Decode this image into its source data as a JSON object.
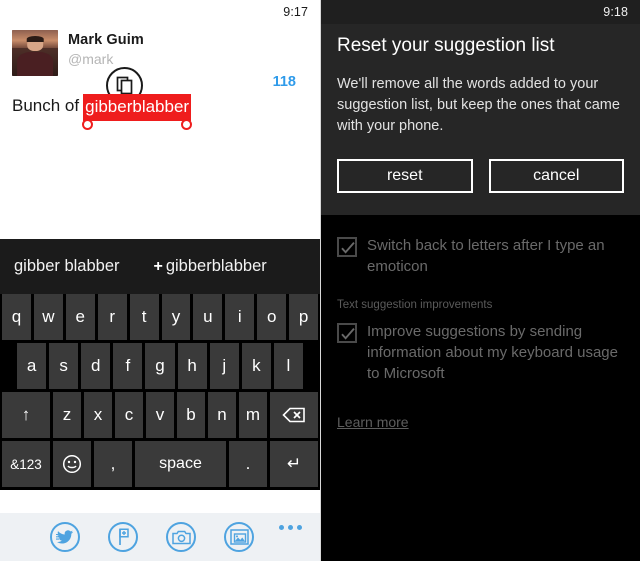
{
  "left_phone": {
    "status": {
      "time": "9:17"
    },
    "tweet": {
      "display_name": "Mark Guim",
      "handle": "@mark",
      "char_counter": "118",
      "text_prefix": "Bunch of",
      "text_selected": "gibberblabber",
      "copy_icon": "copy-icon",
      "selection_color": "#ef1d1d",
      "counter_color": "#2f9bea"
    },
    "keyboard": {
      "suggestions": [
        {
          "label": "gibber blabber",
          "has_plus": false
        },
        {
          "label": "gibberblabber",
          "has_plus": true,
          "plus": "+"
        }
      ],
      "row1": [
        "q",
        "w",
        "e",
        "r",
        "t",
        "y",
        "u",
        "i",
        "o",
        "p"
      ],
      "row2": [
        "a",
        "s",
        "d",
        "f",
        "g",
        "h",
        "j",
        "k",
        "l"
      ],
      "row3": [
        "z",
        "x",
        "c",
        "v",
        "b",
        "n",
        "m"
      ],
      "shift_label": "↑",
      "backspace_label": "backspace-icon",
      "numeric_label": "&123",
      "emoji_label": "emoji-icon",
      "comma_label": ",",
      "space_label": "space",
      "period_label": ".",
      "enter_label": "↵"
    },
    "bottom_bar": {
      "icons": [
        "tweet-icon",
        "location-pin-icon",
        "camera-icon",
        "photos-icon"
      ],
      "more_label": "more-options-icon"
    }
  },
  "right_phone": {
    "status": {
      "time": "9:18"
    },
    "dialog": {
      "title": "Reset your suggestion list",
      "body": "We'll remove all the words added to your suggestion list, but keep the ones that came with your phone.",
      "confirm_label": "reset",
      "cancel_label": "cancel"
    },
    "settings": {
      "checkbox1": {
        "label": "Switch back to letters after I type an emoticon",
        "checked": true
      },
      "section_header": "Text suggestion improvements",
      "checkbox2": {
        "label": "Improve suggestions by sending information about my keyboard usage to Microsoft",
        "checked": true
      },
      "learn_more_label": "Learn more"
    }
  }
}
